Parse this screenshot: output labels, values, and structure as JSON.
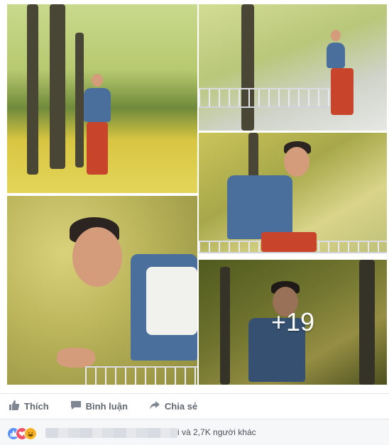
{
  "post": {
    "photo_overlay_count": "+19",
    "photos": [
      {
        "name": "photo-walking-park"
      },
      {
        "name": "photo-sitting-railing"
      },
      {
        "name": "photo-portrait-vest"
      },
      {
        "name": "photo-closeup-smile"
      },
      {
        "name": "photo-more"
      }
    ]
  },
  "actions": {
    "like": "Thích",
    "comment": "Bình luận",
    "share": "Chia sẻ"
  },
  "reactions": {
    "summary": "i và 2,7K người khác",
    "icons": [
      "like-icon",
      "love-icon",
      "haha-icon"
    ]
  },
  "colors": {
    "like": "#5890ff",
    "love": "#f25268",
    "haha": "#f7b125",
    "action_text": "#616770"
  }
}
